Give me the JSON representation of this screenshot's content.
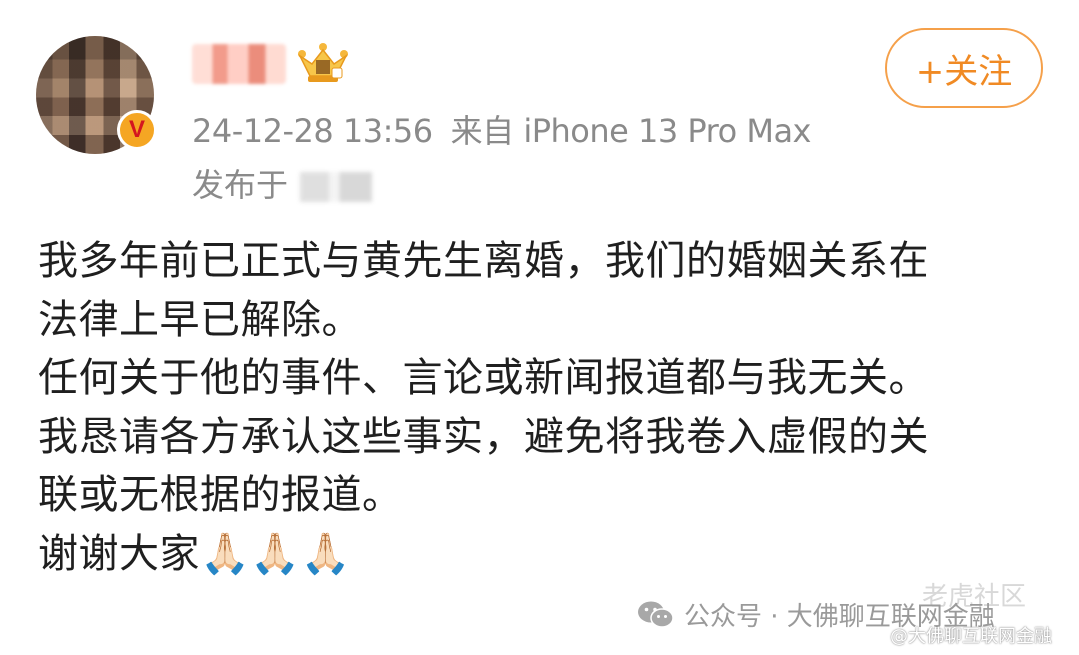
{
  "post": {
    "timestamp": "24-12-28 13:56",
    "source": "来自 iPhone 13 Pro Max",
    "location_prefix": "发布于",
    "follow_label": "+关注",
    "verified_mark": "V",
    "lines": [
      "我多年前已正式与黄先生离婚，我们的婚姻关系在",
      "法律上早已解除。",
      "任何关于他的事件、言论或新闻报道都与我无关。",
      "我恳请各方承认这些事实，避免将我卷入虚假的关",
      "联或无根据的报道。",
      "谢谢大家🙏🏻🙏🏻🙏🏻"
    ]
  },
  "watermarks": {
    "tiger": "老虎社区",
    "wechat": "公众号 · 大佛聊互联网金融",
    "handle": "@大佛聊互联网金融"
  },
  "icons": {
    "avatar": "avatar-blurred",
    "badge": "verified-badge-icon",
    "crown": "crown-icon",
    "wechat": "wechat-icon"
  },
  "colors": {
    "accent": "#f08a24",
    "meta_text": "#8a8a8a",
    "badge": "#f5a623"
  }
}
